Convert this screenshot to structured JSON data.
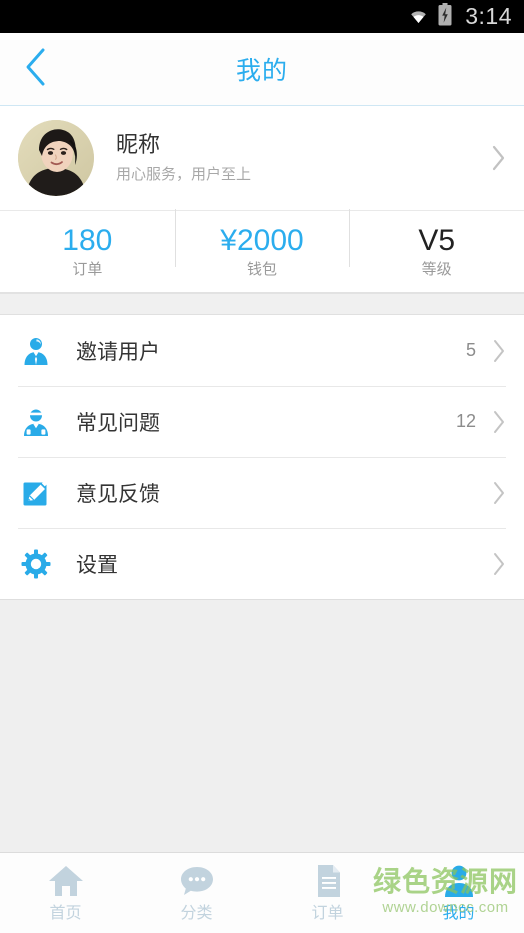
{
  "statusbar": {
    "time": "3:14",
    "wifi_icon": "wifi-icon",
    "battery_icon": "battery-charging-icon"
  },
  "header": {
    "title": "我的",
    "back_icon": "back-chevron-icon",
    "accent_color": "#2badee"
  },
  "profile": {
    "name": "昵称",
    "subtitle": "用心服务，用户至上",
    "avatar_icon": "user-avatar-photo",
    "chevron_icon": "chevron-right-icon"
  },
  "stats": [
    {
      "value": "180",
      "label": "订单",
      "color": "#2badee"
    },
    {
      "value": "¥2000",
      "label": "钱包",
      "color": "#2badee"
    },
    {
      "value": "V5",
      "label": "等级",
      "color": "#222222"
    }
  ],
  "menu": [
    {
      "label": "邀请用户",
      "count": "5",
      "icon": "invite-user-icon"
    },
    {
      "label": "常见问题",
      "count": "12",
      "icon": "faq-support-icon"
    },
    {
      "label": "意见反馈",
      "count": "",
      "icon": "feedback-pencil-icon"
    },
    {
      "label": "设置",
      "count": "",
      "icon": "settings-gear-icon"
    }
  ],
  "tabbar": [
    {
      "label": "首页",
      "icon": "home-icon",
      "active": false
    },
    {
      "label": "分类",
      "icon": "chat-bubble-icon",
      "active": false
    },
    {
      "label": "订单",
      "icon": "document-icon",
      "active": false
    },
    {
      "label": "我的",
      "icon": "person-icon",
      "active": true
    }
  ],
  "watermark": {
    "site_name": "绿色资源网",
    "site_url": "www.downcc.com"
  }
}
